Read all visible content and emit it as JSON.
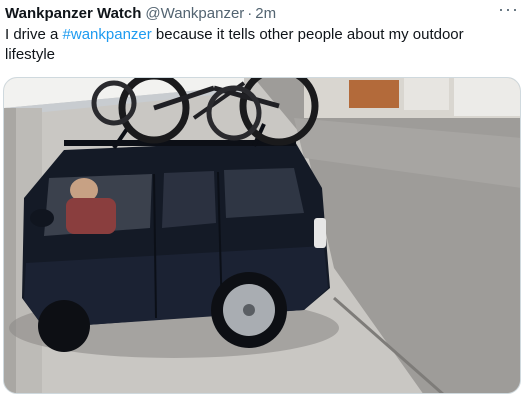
{
  "tweet": {
    "author_name": "Wankpanzer Watch",
    "author_handle": "@Wankpanzer",
    "separator": "·",
    "timestamp": "2m",
    "more_label": "···",
    "text_before": "I drive a ",
    "hashtag": "#wankpanzer",
    "text_after": " because it tells other people about my outdoor lifestyle"
  },
  "media": {
    "type": "video",
    "description_icon": "video-still"
  },
  "colors": {
    "text": "#0f1419",
    "secondary": "#536471",
    "link": "#1d9bf0",
    "border": "#cfd9de"
  }
}
